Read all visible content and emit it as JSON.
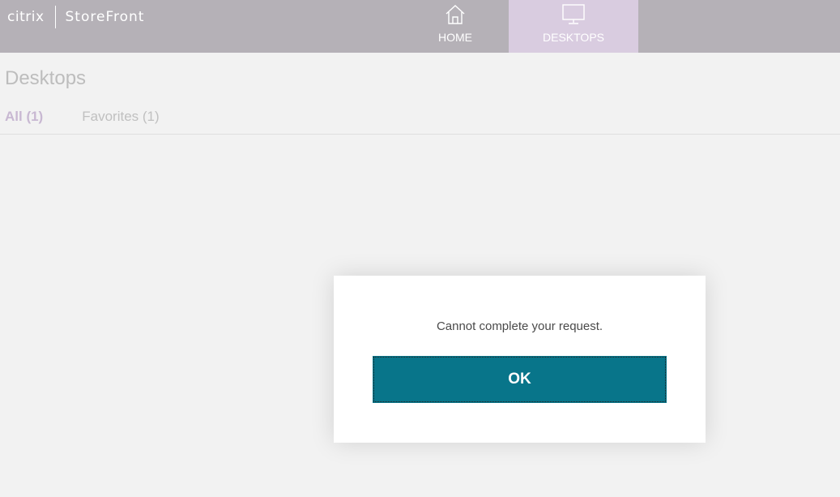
{
  "header": {
    "brand_company": "citrix",
    "brand_product": "StoreFront",
    "nav": [
      {
        "label": "HOME",
        "icon": "home-icon"
      },
      {
        "label": "DESKTOPS",
        "icon": "monitor-icon",
        "active": true
      }
    ]
  },
  "main": {
    "title": "Desktops",
    "filters": [
      {
        "label": "All (1)",
        "active": true
      },
      {
        "label": "Favorites (1)",
        "active": false
      }
    ]
  },
  "dialog": {
    "message": "Cannot complete your request.",
    "ok_label": "OK"
  },
  "colors": {
    "header_bg": "#b5b1b7",
    "active_tab_bg": "#d9cce0",
    "button_bg": "#08758a",
    "page_bg": "#f2f2f2"
  }
}
